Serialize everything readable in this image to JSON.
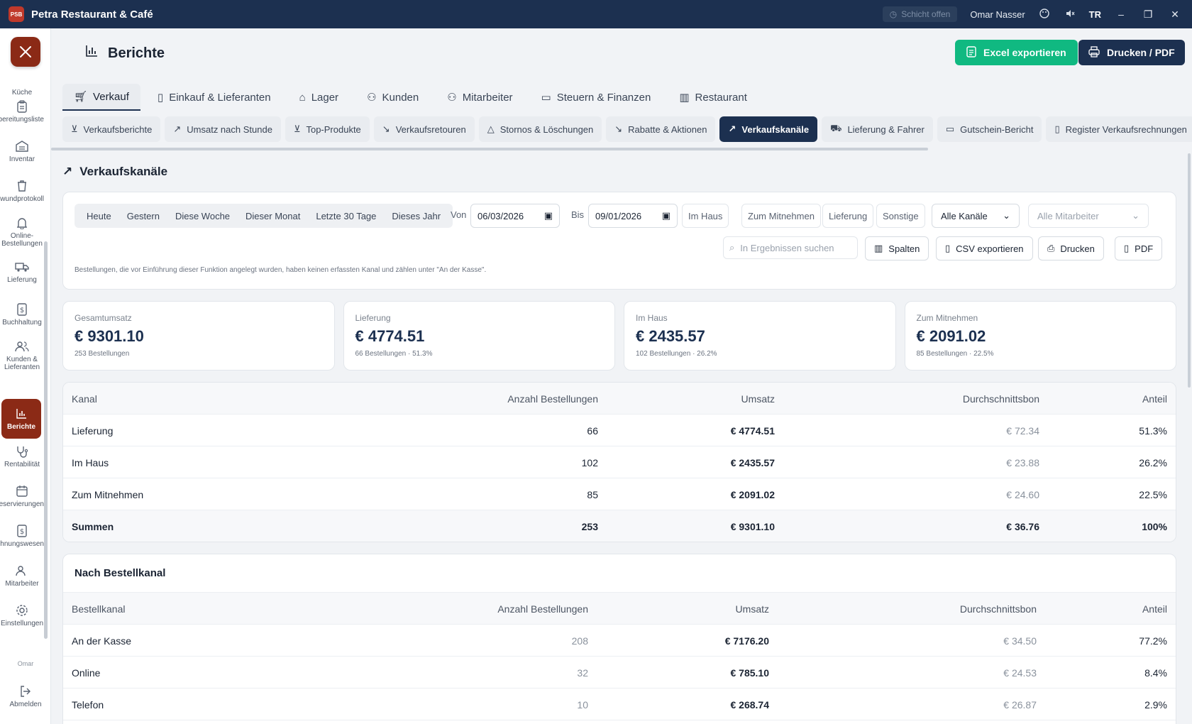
{
  "titlebar": {
    "app_title": "Petra Restaurant & Café",
    "logo_text": "PSB",
    "shift": "Schicht offen",
    "user": "Omar Nasser",
    "lang": "TR"
  },
  "sidebar": {
    "items": [
      {
        "label": "Küche"
      },
      {
        "label": "Zubereitungsliste"
      },
      {
        "label": "Inventar"
      },
      {
        "label": "Schwundprotokoll"
      },
      {
        "label": "Online-Bestellungen"
      },
      {
        "label": "Lieferung"
      },
      {
        "label": "Buchhaltung"
      },
      {
        "label": "Kunden & Lieferanten"
      },
      {
        "label": "Berichte"
      },
      {
        "label": "Rentabilität"
      },
      {
        "label": "Reservierungen"
      },
      {
        "label": "Rechnungswesen"
      },
      {
        "label": "Mitarbeiter"
      },
      {
        "label": "Einstellungen"
      }
    ],
    "user": "Omar",
    "logout": "Abmelden"
  },
  "header": {
    "title": "Berichte",
    "excel": "Excel exportieren",
    "print": "Drucken / PDF"
  },
  "maintabs": [
    {
      "label": "Verkauf"
    },
    {
      "label": "Einkauf & Lieferanten"
    },
    {
      "label": "Lager"
    },
    {
      "label": "Kunden"
    },
    {
      "label": "Mitarbeiter"
    },
    {
      "label": "Steuern & Finanzen"
    },
    {
      "label": "Restaurant"
    }
  ],
  "subtabs": [
    {
      "label": "Verkaufsberichte"
    },
    {
      "label": "Umsatz nach Stunde"
    },
    {
      "label": "Top-Produkte"
    },
    {
      "label": "Verkaufsretouren"
    },
    {
      "label": "Stornos & Löschungen"
    },
    {
      "label": "Rabatte & Aktionen"
    },
    {
      "label": "Verkaufskanäle"
    },
    {
      "label": "Lieferung & Fahrer"
    },
    {
      "label": "Gutschein-Bericht"
    },
    {
      "label": "Register Verkaufsrechnungen"
    }
  ],
  "section_title": "Verkaufskanäle",
  "filters": {
    "quick": [
      "Heute",
      "Gestern",
      "Diese Woche",
      "Dieser Monat",
      "Letzte 30 Tage",
      "Dieses Jahr"
    ],
    "from_label": "Von",
    "from_value": "06/03/2026",
    "to_label": "Bis",
    "to_value": "09/01/2026",
    "chips": [
      "Im Haus",
      "Zum Mitnehmen",
      "Lieferung",
      "Sonstige"
    ],
    "channel_select": "Alle Kanäle",
    "employee_select": "Alle Mitarbeiter",
    "search_placeholder": "In Ergebnissen suchen",
    "columns_btn": "Spalten",
    "csv_btn": "CSV exportieren",
    "print_btn": "Drucken",
    "pdf_btn": "PDF",
    "note": "Bestellungen, die vor Einführung dieser Funktion angelegt wurden, haben keinen erfassten Kanal und zählen unter \"An der Kasse\"."
  },
  "kpis": [
    {
      "label": "Gesamtumsatz",
      "value": "€ 9301.10",
      "sub": "253 Bestellungen"
    },
    {
      "label": "Lieferung",
      "value": "€ 4774.51",
      "sub": "66 Bestellungen · 51.3%"
    },
    {
      "label": "Im Haus",
      "value": "€ 2435.57",
      "sub": "102 Bestellungen · 26.2%"
    },
    {
      "label": "Zum Mitnehmen",
      "value": "€ 2091.02",
      "sub": "85 Bestellungen · 22.5%"
    }
  ],
  "table1": {
    "headers": [
      "Kanal",
      "Anzahl Bestellungen",
      "Umsatz",
      "Durchschnittsbon",
      "Anteil"
    ],
    "rows": [
      [
        "Lieferung",
        "66",
        "€ 4774.51",
        "€ 72.34",
        "51.3%"
      ],
      [
        "Im Haus",
        "102",
        "€ 2435.57",
        "€ 23.88",
        "26.2%"
      ],
      [
        "Zum Mitnehmen",
        "85",
        "€ 2091.02",
        "€ 24.60",
        "22.5%"
      ]
    ],
    "total": [
      "Summen",
      "253",
      "€ 9301.10",
      "€ 36.76",
      "100%"
    ]
  },
  "table2": {
    "title": "Nach Bestellkanal",
    "headers": [
      "Bestellkanal",
      "Anzahl Bestellungen",
      "Umsatz",
      "Durchschnittsbon",
      "Anteil"
    ],
    "rows": [
      [
        "An der Kasse",
        "208",
        "€ 7176.20",
        "€ 34.50",
        "77.2%"
      ],
      [
        "Online",
        "32",
        "€ 785.10",
        "€ 24.53",
        "8.4%"
      ],
      [
        "Telefon",
        "10",
        "€ 268.74",
        "€ 26.87",
        "2.9%"
      ]
    ]
  }
}
